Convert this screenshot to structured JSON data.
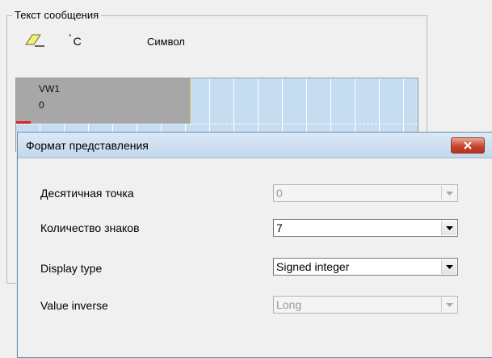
{
  "group": {
    "title": "Текст сообщения"
  },
  "toolbar": {
    "eraser_icon": "eraser-icon",
    "degree_symbol": "°",
    "degree_unit": "C",
    "symbol_label": "Символ"
  },
  "grid": {
    "cell": {
      "name": "VW1",
      "value": "0"
    }
  },
  "dialog": {
    "title": "Формат представления",
    "close_icon": "close-icon",
    "fields": [
      {
        "label": "Десятичная точка",
        "value": "0",
        "enabled": false
      },
      {
        "label": "Количество знаков",
        "value": "7",
        "enabled": true
      },
      {
        "label": "Display type",
        "value": "Signed integer",
        "enabled": true
      },
      {
        "label": "Value inverse",
        "value": "Long",
        "enabled": false
      }
    ]
  },
  "colors": {
    "grid_bg": "#c6dcf0",
    "selected_cell": "#a7a7a7",
    "close_button": "#c8442d"
  }
}
